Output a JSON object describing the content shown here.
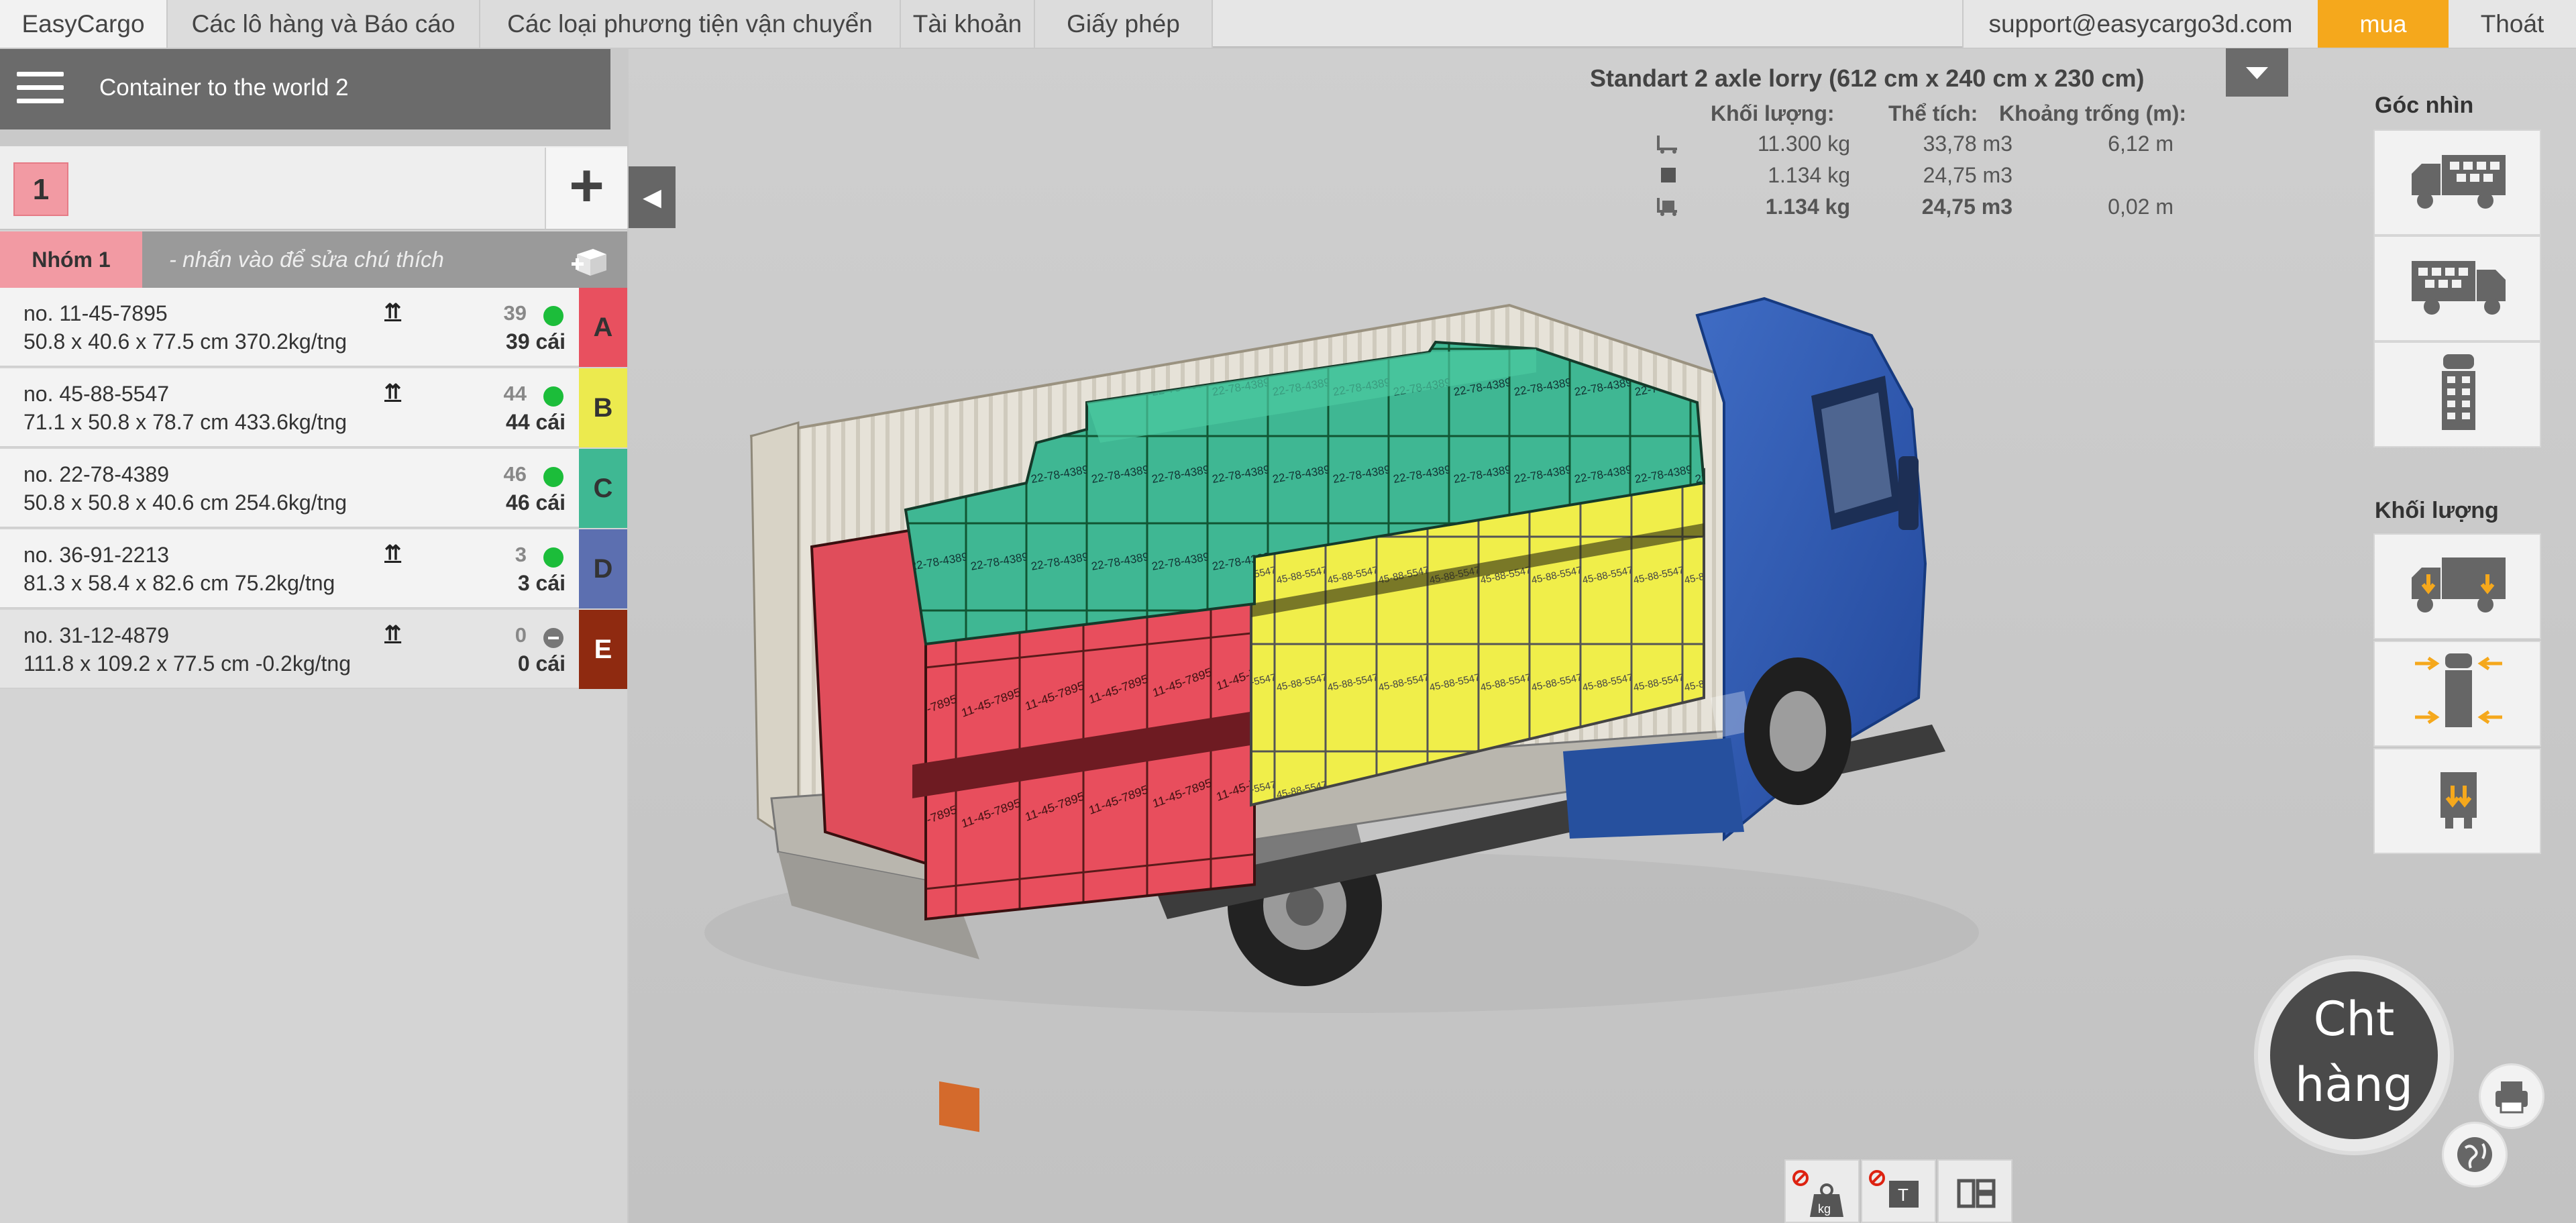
{
  "nav": {
    "brand": "EasyCargo",
    "shipments": "Các lô hàng và Báo cáo",
    "vehicles": "Các loại phương tiện vận chuyển",
    "account": "Tài khoản",
    "license": "Giấy phép",
    "email": "support@easycargo3d.com",
    "buy": "mua",
    "logout": "Thoát"
  },
  "project": {
    "name": "Container to the world 2"
  },
  "group": {
    "number": "1",
    "add": "+",
    "label": "Nhóm 1",
    "note_placeholder": "- nhấn vào để sửa chú thích"
  },
  "cargo": [
    {
      "name": "no. 11-45-7895",
      "dims": "50.8 x 40.6 x 77.5 cm 370.2kg/tng",
      "qty_loaded": "39",
      "qty": "39 cái",
      "stack": "⇈",
      "letter": "A",
      "color": "#e8505f",
      "status": "#1cbd3a"
    },
    {
      "name": "no. 45-88-5547",
      "dims": "71.1 x 50.8 x 78.7 cm 433.6kg/tng",
      "qty_loaded": "44",
      "qty": "44 cái",
      "stack": "⇈",
      "letter": "B",
      "color": "#ecea4e",
      "status": "#1cbd3a"
    },
    {
      "name": "no. 22-78-4389",
      "dims": "50.8 x 50.8 x 40.6 cm 254.6kg/tng",
      "qty_loaded": "46",
      "qty": "46 cái",
      "stack": "",
      "letter": "C",
      "color": "#3fb893",
      "status": "#1cbd3a"
    },
    {
      "name": "no. 36-91-2213",
      "dims": "81.3 x 58.4 x 82.6 cm 75.2kg/tng",
      "qty_loaded": "3",
      "qty": "3 cái",
      "stack": "⇈",
      "letter": "D",
      "color": "#5c6fb0",
      "status": "#1cbd3a"
    },
    {
      "name": "no. 31-12-4879",
      "dims": "111.8 x 109.2 x 77.5 cm -0.2kg/tng",
      "qty_loaded": "0",
      "qty": "0 cái",
      "stack": "⇈",
      "letter": "E",
      "color": "#8f2a10",
      "status": "#777777"
    }
  ],
  "truck": {
    "title": "Standart 2 axle lorry (612 cm x 240 cm x 230 cm)",
    "headers": {
      "weight": "Khối lượng:",
      "volume": "Thể tích:",
      "space": "Khoảng trống (m):"
    },
    "rows": [
      {
        "icon": "cart-icon",
        "weight": "11.300 kg",
        "volume": "33,78 m3",
        "space": "6,12 m"
      },
      {
        "icon": "box-icon",
        "weight": "1.134 kg",
        "volume": "24,75 m3",
        "space": ""
      },
      {
        "icon": "loaded-cart-icon",
        "weight": "1.134 kg",
        "volume": "24,75 m3",
        "space": "0,02 m"
      }
    ]
  },
  "right_panel": {
    "views_title": "Góc nhìn",
    "weight_title": "Khối lượng"
  },
  "load_button": {
    "line1": "Cht",
    "line2": "hàng"
  },
  "colors": {
    "accent": "#f5a81c",
    "panel_dark": "#6b6b6b",
    "truck_blue": "#2f5bb0"
  }
}
